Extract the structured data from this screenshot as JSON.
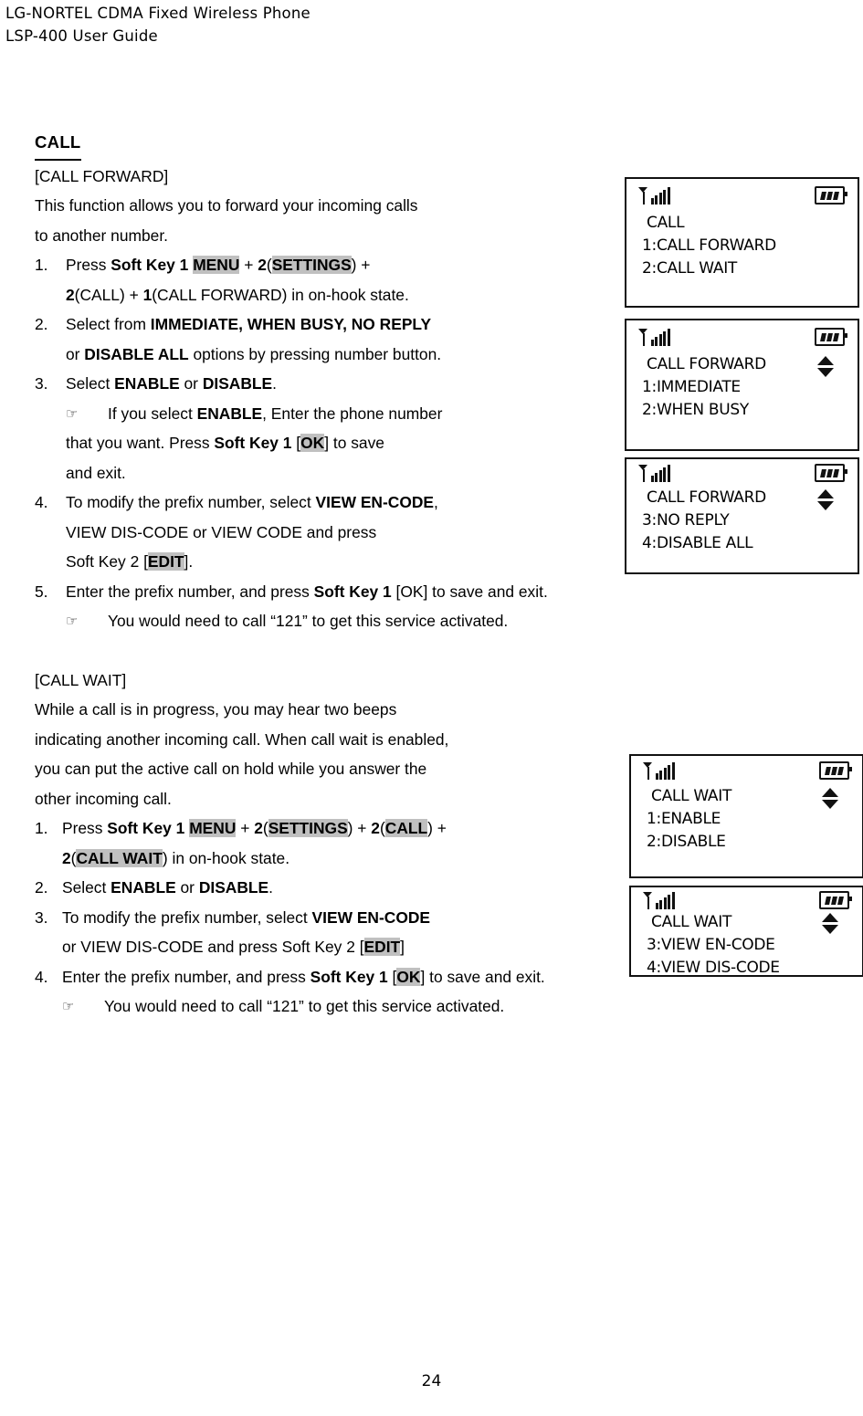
{
  "header": {
    "line1": "LG-NORTEL CDMA Fixed Wireless Phone",
    "line2": "LSP-400 User Guide"
  },
  "section": {
    "title": "CALL ",
    "call_forward": {
      "heading": "[CALL FORWARD]",
      "intro_line1": "This function allows you to forward your incoming calls",
      "intro_line2": "to another number.",
      "steps": [
        {
          "num": "1.",
          "line1": {
            "a": "Press ",
            "b_softkey": "Soft Key 1",
            "sp1": " ",
            "hl_menu": "MENU",
            "c": " + ",
            "b_two": "2",
            "paren_open": "(",
            "hl_settings": "SETTINGS",
            "paren_close": ")",
            "d": " +"
          },
          "line2": {
            "b_two": "2",
            "a": "(CALL) + ",
            "b_one": "1",
            "c": "(CALL FORWARD) in on-hook state."
          }
        },
        {
          "num": "2.",
          "line1": {
            "a": "Select from ",
            "b": "IMMEDIATE, WHEN BUSY, NO REPLY"
          },
          "line2": {
            "a": "or ",
            "b": "DISABLE ALL",
            "c": " options by pressing number button."
          }
        },
        {
          "num": "3.",
          "line1": {
            "a": "Select ",
            "b1": "ENABLE",
            "b": " or ",
            "b2": "DISABLE",
            "c": "."
          }
        }
      ],
      "hand_note": {
        "glyph": "☞",
        "line1": {
          "a": "If you select ",
          "b": "ENABLE",
          "c": ", Enter the phone number"
        },
        "line2": {
          "a": "that you want. Press ",
          "b": "Soft Key 1",
          "c": " [",
          "hl": "OK",
          "d": "] to save"
        },
        "line3": "and exit."
      },
      "step4": {
        "num": "4.",
        "line1": {
          "a": "To modify the prefix number, select ",
          "b": "VIEW EN-CODE",
          "c": ","
        },
        "line2": "VIEW DIS-CODE or VIEW CODE and press",
        "line3": {
          "a": "Soft Key 2 [",
          "hl": "EDIT",
          "b": "]."
        }
      },
      "step5": {
        "num": "5.",
        "line1": {
          "a": "Enter the prefix number, and press ",
          "b": "Soft Key 1",
          "c": " [OK] to save and exit."
        }
      },
      "hand_note2": {
        "glyph": "☞",
        "text": "You would need to call “121” to get this service activated."
      }
    },
    "call_wait": {
      "heading": "[CALL WAIT]",
      "intro_line1": "While a call is in progress, you may hear two beeps",
      "intro_line2": "indicating another incoming call. When call wait is enabled,",
      "intro_line3": "you can put the active call on hold while you answer the",
      "intro_line4": "other incoming call.",
      "steps": [
        {
          "num": "1.",
          "line1": {
            "a": "Press ",
            "b_softkey": "Soft Key 1",
            "sp1": " ",
            "hl_menu": "MENU",
            "c": " + ",
            "b_two": "2",
            "p1": "(",
            "hl_settings": "SETTINGS",
            "p2": ")",
            "d": " + ",
            "b_two2": "2",
            "p3": "(",
            "hl_call": "CALL",
            "p4": ")",
            "e": " +"
          },
          "line2": {
            "b_two": "2",
            "p1": "(",
            "hl_callwait": "CALL WAIT",
            "p2": ")",
            "a": " in on-hook state."
          }
        },
        {
          "num": "2.",
          "line1": {
            "a": "Select ",
            "b1": "ENABLE",
            "b": " or ",
            "b2": "DISABLE",
            "c": "."
          }
        },
        {
          "num": "3.",
          "line1": {
            "a": "To modify the prefix number, select ",
            "b": "VIEW EN-CODE"
          },
          "line2": {
            "a": "or VIEW DIS-CODE and press Soft Key 2 [",
            "hl": "EDIT",
            "b": "]"
          }
        },
        {
          "num": "4.",
          "line1": {
            "a": "Enter the prefix number, and press ",
            "b": "Soft Key 1",
            "c": " [",
            "hl": "OK",
            "d": "] to save and exit."
          }
        }
      ],
      "hand_note": {
        "glyph": "☞",
        "text": "You would need to call “121” to get this service activated."
      }
    }
  },
  "lcd_screens": [
    {
      "id": "lcd-call-menu",
      "line0": "CALL",
      "line1": "1:CALL FORWARD",
      "line2": "2:CALL WAIT",
      "scroll": false
    },
    {
      "id": "lcd-call-forward-1",
      "line0": "CALL FORWARD",
      "line1": "1:IMMEDIATE",
      "line2": "2:WHEN BUSY",
      "scroll": true
    },
    {
      "id": "lcd-call-forward-2",
      "line0": "CALL FORWARD",
      "line1": "3:NO REPLY",
      "line2": "4:DISABLE ALL",
      "scroll": true
    },
    {
      "id": "lcd-call-wait-1",
      "line0": "CALL WAIT",
      "line1": "1:ENABLE",
      "line2": "2:DISABLE",
      "scroll": true
    },
    {
      "id": "lcd-call-wait-2",
      "line0": "CALL WAIT",
      "line1": "3:VIEW EN-CODE",
      "line2": "4:VIEW DIS-CODE",
      "scroll": true
    }
  ],
  "footer": {
    "page_number": "24"
  },
  "colors": {
    "highlight": "#c0c0c0",
    "text": "#000000",
    "background": "#ffffff"
  }
}
